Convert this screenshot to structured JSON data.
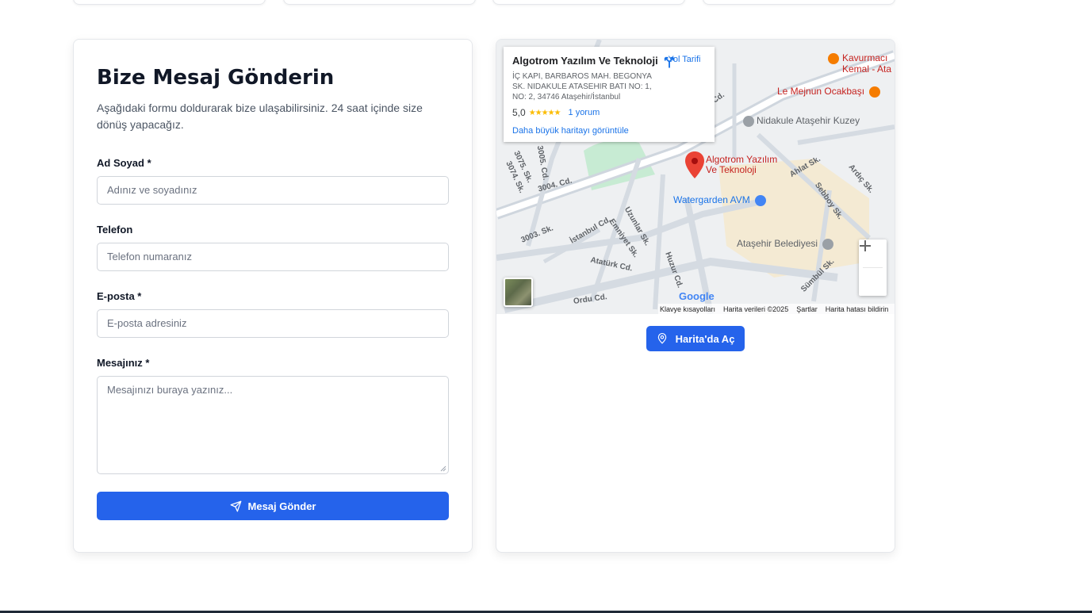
{
  "form": {
    "title": "Bize Mesaj Gönderin",
    "description": "Aşağıdaki formu doldurarak bize ulaşabilirsiniz. 24 saat içinde size dönüş yapacağız.",
    "name_label": "Ad Soyad *",
    "name_placeholder": "Adınız ve soyadınız",
    "phone_label": "Telefon",
    "phone_placeholder": "Telefon numaranız",
    "email_label": "E-posta *",
    "email_placeholder": "E-posta adresiniz",
    "message_label": "Mesajınız *",
    "message_placeholder": "Mesajınızı buraya yazınız...",
    "submit_label": "Mesaj Gönder"
  },
  "map": {
    "place_title": "Algotrom Yazılım Ve Teknoloji",
    "address": "İÇ KAPI, BARBAROS MAH. BEGONYA SK. NIDAKULE ATASEHIR BATI NO: 1, NO: 2, 34746 Ataşehir/İstanbul",
    "rating": "5,0",
    "stars": "★★★★★",
    "reviews": "1 yorum",
    "bigger_map": "Daha büyük haritayı görüntüle",
    "directions": "Yol Tarifi",
    "pin_label_1": "Algotrom Yazılım",
    "pin_label_2": "Ve Teknoloji",
    "poi_kavurmaci_1": "Kavurmacı",
    "poi_kavurmaci_2": "Kemal - Ata",
    "poi_mejnun": "Le Mejnun Ocakbaşı",
    "poi_nidakule": "Nidakule Ataşehir Kuzey",
    "poi_watergarden": "Watergarden AVM",
    "poi_belediye": "Ataşehir Belediyesi",
    "streets": [
      "3004. Cd.",
      "3003. Sk.",
      "İstanbul Cd.",
      "Uzunlar Sk.",
      "Emniyet Sk.",
      "Atatürk Cd.",
      "Huzur Cd.",
      "Ordu Cd.",
      "Ahlat Sk.",
      "Ardıç Sk.",
      "Sebboy Sk.",
      "Sümbül Sk.",
      "3005. Cd.",
      "3075. Sk.",
      "3074. Sk.",
      "Cd."
    ],
    "google": "Google",
    "footer_shortcuts": "Klavye kısayolları",
    "footer_data": "Harita verileri ©2025",
    "footer_terms": "Şartlar",
    "footer_report": "Harita hatası bildirin",
    "open_button": "Harita'da Aç"
  }
}
